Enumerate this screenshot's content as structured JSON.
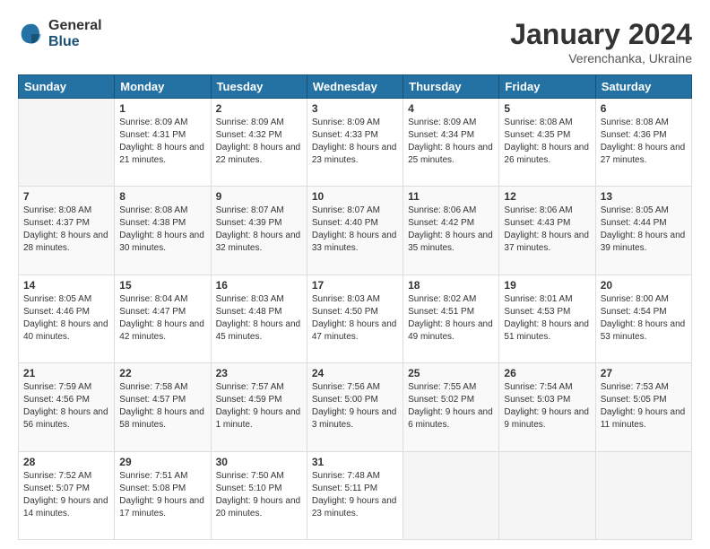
{
  "header": {
    "logo_general": "General",
    "logo_blue": "Blue",
    "main_title": "January 2024",
    "sub_title": "Verenchanka, Ukraine"
  },
  "calendar": {
    "headers": [
      "Sunday",
      "Monday",
      "Tuesday",
      "Wednesday",
      "Thursday",
      "Friday",
      "Saturday"
    ],
    "weeks": [
      [
        {
          "day": "",
          "sunrise": "",
          "sunset": "",
          "daylight": "",
          "empty": true
        },
        {
          "day": "1",
          "sunrise": "Sunrise: 8:09 AM",
          "sunset": "Sunset: 4:31 PM",
          "daylight": "Daylight: 8 hours and 21 minutes."
        },
        {
          "day": "2",
          "sunrise": "Sunrise: 8:09 AM",
          "sunset": "Sunset: 4:32 PM",
          "daylight": "Daylight: 8 hours and 22 minutes."
        },
        {
          "day": "3",
          "sunrise": "Sunrise: 8:09 AM",
          "sunset": "Sunset: 4:33 PM",
          "daylight": "Daylight: 8 hours and 23 minutes."
        },
        {
          "day": "4",
          "sunrise": "Sunrise: 8:09 AM",
          "sunset": "Sunset: 4:34 PM",
          "daylight": "Daylight: 8 hours and 25 minutes."
        },
        {
          "day": "5",
          "sunrise": "Sunrise: 8:08 AM",
          "sunset": "Sunset: 4:35 PM",
          "daylight": "Daylight: 8 hours and 26 minutes."
        },
        {
          "day": "6",
          "sunrise": "Sunrise: 8:08 AM",
          "sunset": "Sunset: 4:36 PM",
          "daylight": "Daylight: 8 hours and 27 minutes."
        }
      ],
      [
        {
          "day": "7",
          "sunrise": "Sunrise: 8:08 AM",
          "sunset": "Sunset: 4:37 PM",
          "daylight": "Daylight: 8 hours and 28 minutes."
        },
        {
          "day": "8",
          "sunrise": "Sunrise: 8:08 AM",
          "sunset": "Sunset: 4:38 PM",
          "daylight": "Daylight: 8 hours and 30 minutes."
        },
        {
          "day": "9",
          "sunrise": "Sunrise: 8:07 AM",
          "sunset": "Sunset: 4:39 PM",
          "daylight": "Daylight: 8 hours and 32 minutes."
        },
        {
          "day": "10",
          "sunrise": "Sunrise: 8:07 AM",
          "sunset": "Sunset: 4:40 PM",
          "daylight": "Daylight: 8 hours and 33 minutes."
        },
        {
          "day": "11",
          "sunrise": "Sunrise: 8:06 AM",
          "sunset": "Sunset: 4:42 PM",
          "daylight": "Daylight: 8 hours and 35 minutes."
        },
        {
          "day": "12",
          "sunrise": "Sunrise: 8:06 AM",
          "sunset": "Sunset: 4:43 PM",
          "daylight": "Daylight: 8 hours and 37 minutes."
        },
        {
          "day": "13",
          "sunrise": "Sunrise: 8:05 AM",
          "sunset": "Sunset: 4:44 PM",
          "daylight": "Daylight: 8 hours and 39 minutes."
        }
      ],
      [
        {
          "day": "14",
          "sunrise": "Sunrise: 8:05 AM",
          "sunset": "Sunset: 4:46 PM",
          "daylight": "Daylight: 8 hours and 40 minutes."
        },
        {
          "day": "15",
          "sunrise": "Sunrise: 8:04 AM",
          "sunset": "Sunset: 4:47 PM",
          "daylight": "Daylight: 8 hours and 42 minutes."
        },
        {
          "day": "16",
          "sunrise": "Sunrise: 8:03 AM",
          "sunset": "Sunset: 4:48 PM",
          "daylight": "Daylight: 8 hours and 45 minutes."
        },
        {
          "day": "17",
          "sunrise": "Sunrise: 8:03 AM",
          "sunset": "Sunset: 4:50 PM",
          "daylight": "Daylight: 8 hours and 47 minutes."
        },
        {
          "day": "18",
          "sunrise": "Sunrise: 8:02 AM",
          "sunset": "Sunset: 4:51 PM",
          "daylight": "Daylight: 8 hours and 49 minutes."
        },
        {
          "day": "19",
          "sunrise": "Sunrise: 8:01 AM",
          "sunset": "Sunset: 4:53 PM",
          "daylight": "Daylight: 8 hours and 51 minutes."
        },
        {
          "day": "20",
          "sunrise": "Sunrise: 8:00 AM",
          "sunset": "Sunset: 4:54 PM",
          "daylight": "Daylight: 8 hours and 53 minutes."
        }
      ],
      [
        {
          "day": "21",
          "sunrise": "Sunrise: 7:59 AM",
          "sunset": "Sunset: 4:56 PM",
          "daylight": "Daylight: 8 hours and 56 minutes."
        },
        {
          "day": "22",
          "sunrise": "Sunrise: 7:58 AM",
          "sunset": "Sunset: 4:57 PM",
          "daylight": "Daylight: 8 hours and 58 minutes."
        },
        {
          "day": "23",
          "sunrise": "Sunrise: 7:57 AM",
          "sunset": "Sunset: 4:59 PM",
          "daylight": "Daylight: 9 hours and 1 minute."
        },
        {
          "day": "24",
          "sunrise": "Sunrise: 7:56 AM",
          "sunset": "Sunset: 5:00 PM",
          "daylight": "Daylight: 9 hours and 3 minutes."
        },
        {
          "day": "25",
          "sunrise": "Sunrise: 7:55 AM",
          "sunset": "Sunset: 5:02 PM",
          "daylight": "Daylight: 9 hours and 6 minutes."
        },
        {
          "day": "26",
          "sunrise": "Sunrise: 7:54 AM",
          "sunset": "Sunset: 5:03 PM",
          "daylight": "Daylight: 9 hours and 9 minutes."
        },
        {
          "day": "27",
          "sunrise": "Sunrise: 7:53 AM",
          "sunset": "Sunset: 5:05 PM",
          "daylight": "Daylight: 9 hours and 11 minutes."
        }
      ],
      [
        {
          "day": "28",
          "sunrise": "Sunrise: 7:52 AM",
          "sunset": "Sunset: 5:07 PM",
          "daylight": "Daylight: 9 hours and 14 minutes."
        },
        {
          "day": "29",
          "sunrise": "Sunrise: 7:51 AM",
          "sunset": "Sunset: 5:08 PM",
          "daylight": "Daylight: 9 hours and 17 minutes."
        },
        {
          "day": "30",
          "sunrise": "Sunrise: 7:50 AM",
          "sunset": "Sunset: 5:10 PM",
          "daylight": "Daylight: 9 hours and 20 minutes."
        },
        {
          "day": "31",
          "sunrise": "Sunrise: 7:48 AM",
          "sunset": "Sunset: 5:11 PM",
          "daylight": "Daylight: 9 hours and 23 minutes."
        },
        {
          "day": "",
          "sunrise": "",
          "sunset": "",
          "daylight": "",
          "empty": true
        },
        {
          "day": "",
          "sunrise": "",
          "sunset": "",
          "daylight": "",
          "empty": true
        },
        {
          "day": "",
          "sunrise": "",
          "sunset": "",
          "daylight": "",
          "empty": true
        }
      ]
    ]
  }
}
